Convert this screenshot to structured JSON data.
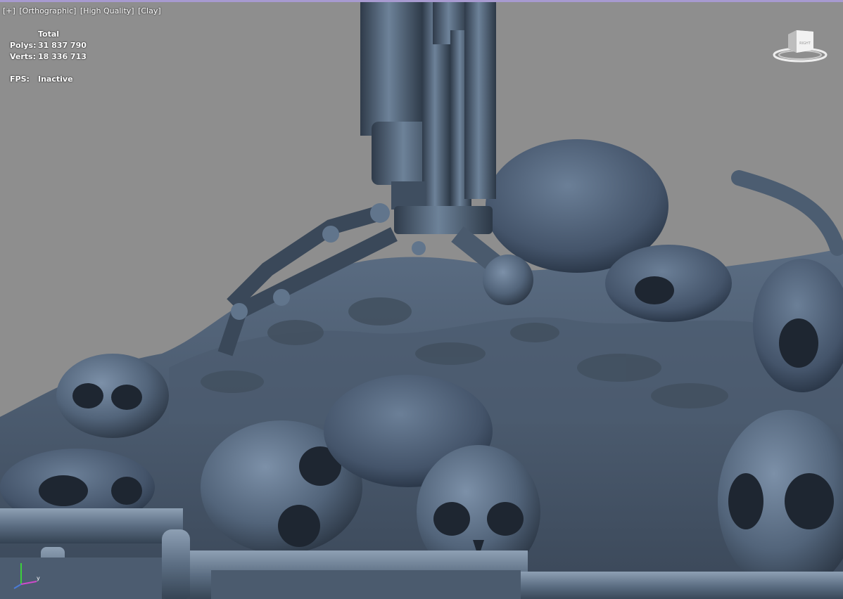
{
  "viewport": {
    "labels": [
      "[+]",
      "[Orthographic]",
      "[High Quality]",
      "[Clay]"
    ],
    "stats": {
      "header": "Total",
      "polys_label": "Polys:",
      "polys_value": "31 837 790",
      "verts_label": "Verts:",
      "verts_value": "18 336 713",
      "fps_label": "FPS:",
      "fps_value": "Inactive"
    },
    "viewcube_face": "RIGHT",
    "background_color": "#8e8e8e",
    "clay_color": "#5b6d82",
    "icons": {
      "viewcube": "viewcube-icon",
      "axis": "axis-tripod-icon"
    }
  }
}
